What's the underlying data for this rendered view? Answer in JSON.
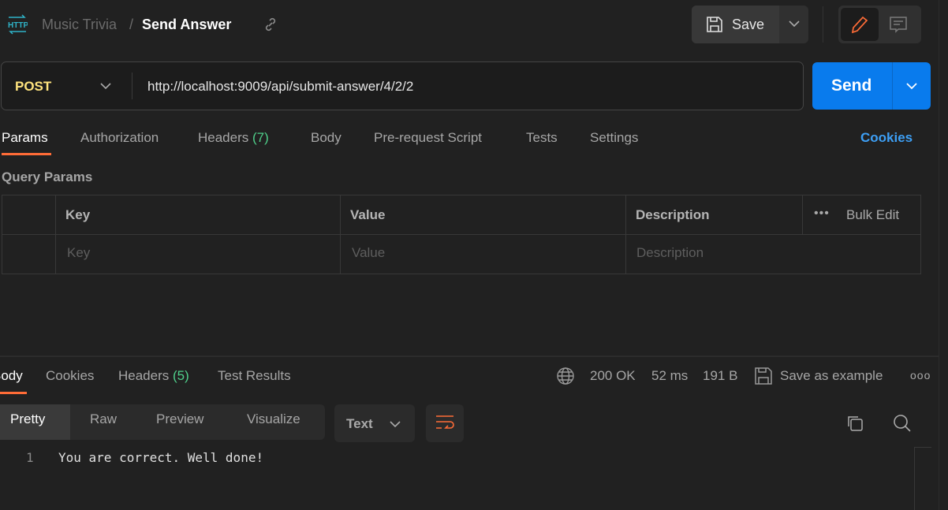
{
  "header": {
    "breadcrumb_parent": "Music Trivia",
    "separator": "/",
    "title": "Send Answer",
    "save_label": "Save",
    "icons": [
      "http-icon",
      "link-icon",
      "save-icon",
      "chevron-down-icon",
      "pencil-icon",
      "comment-icon"
    ]
  },
  "request": {
    "method": "POST",
    "url": "http://localhost:9009/api/submit-answer/4/2/2",
    "send_label": "Send"
  },
  "request_tabs": [
    {
      "label": "Params",
      "active": true
    },
    {
      "label": "Authorization"
    },
    {
      "label": "Headers",
      "count": "(7)"
    },
    {
      "label": "Body"
    },
    {
      "label": "Pre-request Script"
    },
    {
      "label": "Tests"
    },
    {
      "label": "Settings"
    }
  ],
  "cookies_link": "Cookies",
  "params": {
    "section_title": "Query Params",
    "headers": [
      "Key",
      "Value",
      "Description"
    ],
    "bulk_edit": "Bulk Edit",
    "placeholders": [
      "Key",
      "Value",
      "Description"
    ]
  },
  "response_tabs": [
    {
      "label": "Body",
      "active": true
    },
    {
      "label": "Cookies"
    },
    {
      "label": "Headers",
      "count": "(5)"
    },
    {
      "label": "Test Results"
    }
  ],
  "status": {
    "code": "200 OK",
    "time": "52 ms",
    "size": "191 B",
    "save_example": "Save as example"
  },
  "view_modes": [
    "Pretty",
    "Raw",
    "Preview",
    "Visualize"
  ],
  "format": "Text",
  "body_lines": [
    {
      "n": "1",
      "text": "You are correct. Well done!"
    }
  ],
  "colors": {
    "accent": "#ff6c37",
    "send": "#097bed",
    "success": "#4fcf8a",
    "http_icon": "#2fb3c8"
  }
}
